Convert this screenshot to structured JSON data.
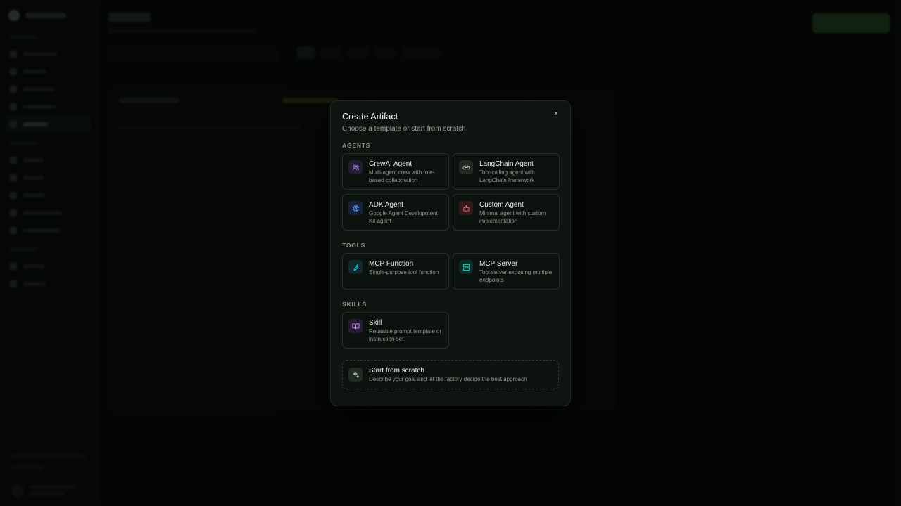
{
  "modal": {
    "title": "Create Artifact",
    "subtitle": "Choose a template or start from scratch",
    "close_icon": "×",
    "sections": {
      "agents": {
        "label": "AGENTS",
        "items": [
          {
            "name": "CrewAI Agent",
            "desc": "Multi-agent crew with role-based collaboration",
            "icon": "users-icon",
            "color": "#a78bfa",
            "bg": "#221d33"
          },
          {
            "name": "LangChain Agent",
            "desc": "Tool-calling agent with LangChain framework",
            "icon": "link-icon",
            "color": "#c7ccc8",
            "bg": "#222a24"
          },
          {
            "name": "ADK Agent",
            "desc": "Google Agent Development Kit agent",
            "icon": "cpu-icon",
            "color": "#60a5fa",
            "bg": "#17223a"
          },
          {
            "name": "Custom Agent",
            "desc": "Minimal agent with custom implementation",
            "icon": "bot-icon",
            "color": "#f87171",
            "bg": "#331a1c"
          }
        ]
      },
      "tools": {
        "label": "TOOLS",
        "items": [
          {
            "name": "MCP Function",
            "desc": "Single-purpose tool function",
            "icon": "wrench-icon",
            "color": "#22d3ee",
            "bg": "#10292e"
          },
          {
            "name": "MCP Server",
            "desc": "Tool server exposing multiple endpoints",
            "icon": "server-icon",
            "color": "#2dd4bf",
            "bg": "#0f2a27"
          }
        ]
      },
      "skills": {
        "label": "SKILLS",
        "items": [
          {
            "name": "Skill",
            "desc": "Reusable prompt template or instruction set",
            "icon": "book-icon",
            "color": "#c084fc",
            "bg": "#271c33"
          }
        ]
      }
    },
    "scratch": {
      "name": "Start from scratch",
      "desc": "Describe your goal and let the factory decide the best approach",
      "icon": "sparkles-icon"
    }
  }
}
